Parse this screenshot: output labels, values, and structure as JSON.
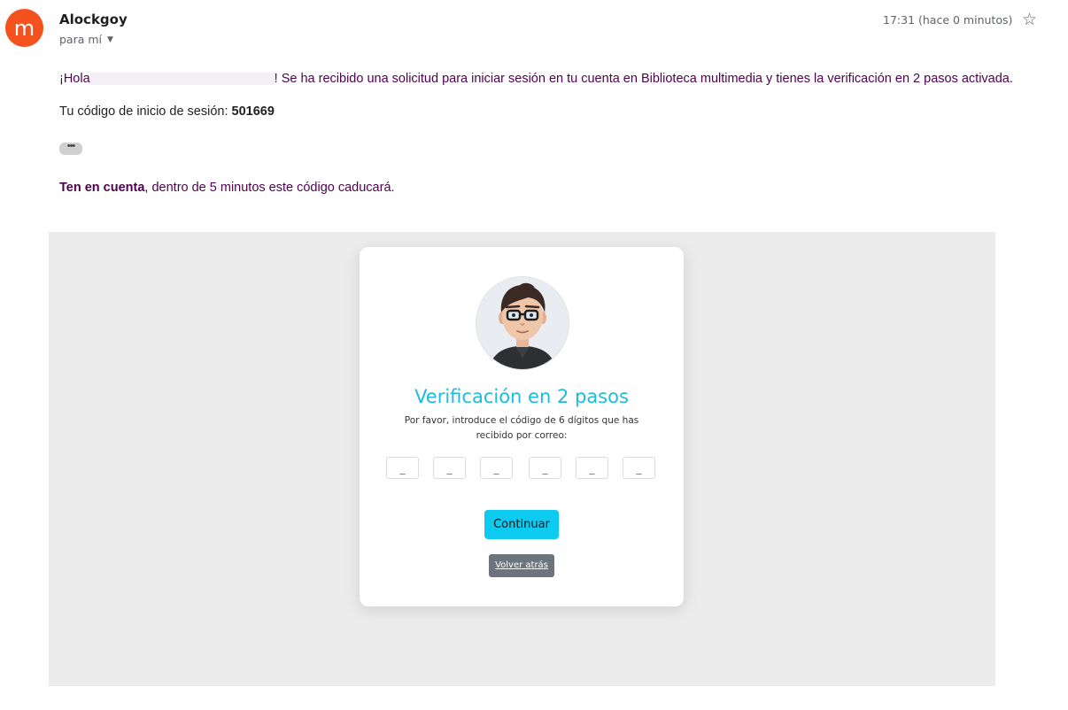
{
  "email": {
    "sender_initial": "m",
    "sender_name": "Alockgoy",
    "recipient_label": "para mí",
    "timestamp": "17:31 (hace 0 minutos)",
    "body": {
      "greeting_prefix": "¡Hola",
      "greeting_suffix": "! Se ha recibido una solicitud para iniciar sesión en tu cuenta en Biblioteca multimedia y tienes la verificación en 2 pasos activada.",
      "code_label": "Tu código de inicio de sesión: ",
      "code": "501669",
      "trim_label": "•••",
      "note_bold": "Ten en cuenta",
      "note_rest": ", dentro de 5 minutos este código caducará."
    }
  },
  "card": {
    "title": "Verificación en 2 pasos",
    "description": "Por favor, introduce el código de 6 dígitos que has recibido por correo:",
    "digit_placeholder": "_",
    "continue_label": "Continuar",
    "back_label": "Volver atrás"
  },
  "colors": {
    "avatar": "#f4511e",
    "body_text": "#500050",
    "title": "#1cbcdb",
    "continue_button": "#0dcaf0",
    "back_button": "#6c757d",
    "panel_background": "#ececec"
  },
  "icons": {
    "star": "star-outline-icon",
    "caret": "caret-down-icon"
  }
}
